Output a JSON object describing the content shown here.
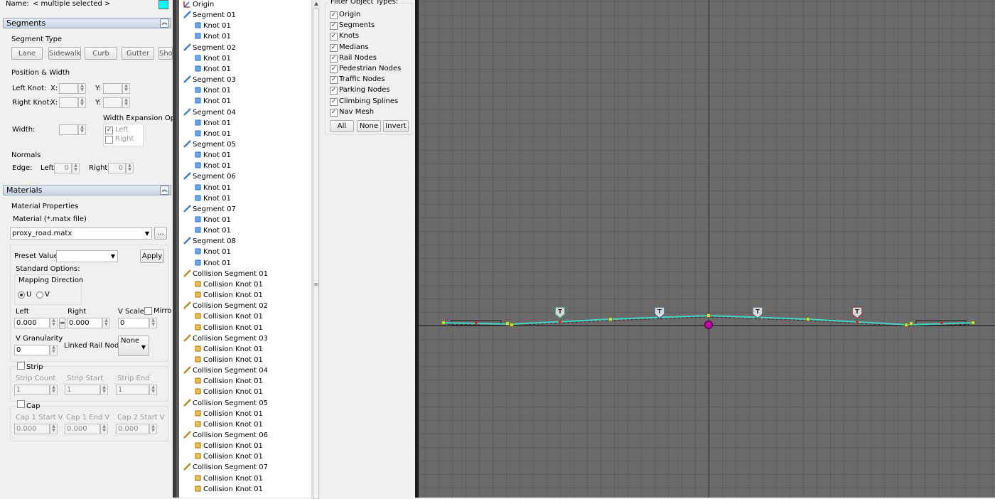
{
  "name_row": {
    "label": "Name:",
    "value": "< multiple selected >",
    "color": "#00ffff"
  },
  "segments_section": {
    "header": "Segments",
    "segment_type_label": "Segment Type",
    "segment_types": [
      "Lane",
      "Sidewalk",
      "Curb",
      "Gutter",
      "Sho"
    ],
    "position_width_label": "Position & Width",
    "left_knot_label": "Left Knot:",
    "right_knot_label": "Right Knot:",
    "x_label": "X:",
    "y_label": "Y:",
    "width_label": "Width:",
    "width_expansion_label": "Width Expansion Optic",
    "expansion_left": "Left",
    "expansion_right": "Right",
    "normals_label": "Normals",
    "edge_label": "Edge:",
    "left_label": "Left:",
    "right_label": "Right:",
    "left_value": "0",
    "right_value": "0"
  },
  "materials_section": {
    "header": "Materials",
    "material_properties_label": "Material Properties",
    "material_file_label": "Material (*.matx file)",
    "material_value": "proxy_road.matx",
    "browse_label": "...",
    "preset_values_label": "Preset Values:",
    "apply_label": "Apply",
    "standard_options_label": "Standard Options:",
    "mapping_direction_label": "Mapping Direction",
    "u_label": "U",
    "v_label": "V",
    "left_label": "Left",
    "right_label": "Right",
    "vscale_label": "V Scale",
    "mirror_label": "Mirro",
    "left_value": "0.000",
    "right_value": "0.000",
    "vscale_value": "0",
    "eq_label": "=",
    "v_granularity_label": "V Granularity",
    "v_granularity_value": "0",
    "linked_rail_label": "Linked Rail Node:",
    "linked_rail_value": "None",
    "strip_label": "Strip",
    "strip_count_label": "Strip Count",
    "strip_start_label": "Strip Start",
    "strip_end_label": "Strip End",
    "strip_count_value": "1",
    "strip_start_value": "1",
    "strip_end_value": "1",
    "cap_label": "Cap",
    "cap1_start_label": "Cap 1 Start V",
    "cap1_end_label": "Cap 1 End V",
    "cap2_start_label": "Cap 2 Start V",
    "cap1_start_value": "0.000",
    "cap1_end_value": "0.000",
    "cap2_start_value": "0.000"
  },
  "tree": [
    {
      "label": "Origin",
      "type": "origin",
      "indent": 0
    },
    {
      "label": "Segment 01",
      "type": "segment",
      "indent": 0
    },
    {
      "label": "Knot 01",
      "type": "knot",
      "indent": 1
    },
    {
      "label": "Knot 01",
      "type": "knot",
      "indent": 1
    },
    {
      "label": "Segment 02",
      "type": "segment",
      "indent": 0
    },
    {
      "label": "Knot 01",
      "type": "knot",
      "indent": 1
    },
    {
      "label": "Knot 01",
      "type": "knot",
      "indent": 1
    },
    {
      "label": "Segment 03",
      "type": "segment",
      "indent": 0
    },
    {
      "label": "Knot 01",
      "type": "knot",
      "indent": 1
    },
    {
      "label": "Knot 01",
      "type": "knot",
      "indent": 1
    },
    {
      "label": "Segment 04",
      "type": "segment",
      "indent": 0
    },
    {
      "label": "Knot 01",
      "type": "knot",
      "indent": 1
    },
    {
      "label": "Knot 01",
      "type": "knot",
      "indent": 1
    },
    {
      "label": "Segment 05",
      "type": "segment",
      "indent": 0
    },
    {
      "label": "Knot 01",
      "type": "knot",
      "indent": 1
    },
    {
      "label": "Knot 01",
      "type": "knot",
      "indent": 1
    },
    {
      "label": "Segment 06",
      "type": "segment",
      "indent": 0
    },
    {
      "label": "Knot 01",
      "type": "knot",
      "indent": 1
    },
    {
      "label": "Knot 01",
      "type": "knot",
      "indent": 1
    },
    {
      "label": "Segment 07",
      "type": "segment",
      "indent": 0
    },
    {
      "label": "Knot 01",
      "type": "knot",
      "indent": 1
    },
    {
      "label": "Knot 01",
      "type": "knot",
      "indent": 1
    },
    {
      "label": "Segment 08",
      "type": "segment",
      "indent": 0
    },
    {
      "label": "Knot 01",
      "type": "knot",
      "indent": 1
    },
    {
      "label": "Knot 01",
      "type": "knot",
      "indent": 1
    },
    {
      "label": "Collision Segment 01",
      "type": "collision-segment",
      "indent": 0
    },
    {
      "label": "Collision Knot 01",
      "type": "collision-knot",
      "indent": 1
    },
    {
      "label": "Collision Knot 01",
      "type": "collision-knot",
      "indent": 1
    },
    {
      "label": "Collision Segment 02",
      "type": "collision-segment",
      "indent": 0
    },
    {
      "label": "Collision Knot 01",
      "type": "collision-knot",
      "indent": 1
    },
    {
      "label": "Collision Knot 01",
      "type": "collision-knot",
      "indent": 1
    },
    {
      "label": "Collision Segment 03",
      "type": "collision-segment",
      "indent": 0
    },
    {
      "label": "Collision Knot 01",
      "type": "collision-knot",
      "indent": 1
    },
    {
      "label": "Collision Knot 01",
      "type": "collision-knot",
      "indent": 1
    },
    {
      "label": "Collision Segment 04",
      "type": "collision-segment",
      "indent": 0
    },
    {
      "label": "Collision Knot 01",
      "type": "collision-knot",
      "indent": 1
    },
    {
      "label": "Collision Knot 01",
      "type": "collision-knot",
      "indent": 1
    },
    {
      "label": "Collision Segment 05",
      "type": "collision-segment",
      "indent": 0
    },
    {
      "label": "Collision Knot 01",
      "type": "collision-knot",
      "indent": 1
    },
    {
      "label": "Collision Knot 01",
      "type": "collision-knot",
      "indent": 1
    },
    {
      "label": "Collision Segment 06",
      "type": "collision-segment",
      "indent": 0
    },
    {
      "label": "Collision Knot 01",
      "type": "collision-knot",
      "indent": 1
    },
    {
      "label": "Collision Knot 01",
      "type": "collision-knot",
      "indent": 1
    },
    {
      "label": "Collision Segment 07",
      "type": "collision-segment",
      "indent": 0
    },
    {
      "label": "Collision Knot 01",
      "type": "collision-knot",
      "indent": 1
    },
    {
      "label": "Collision Knot 01",
      "type": "collision-knot",
      "indent": 1
    }
  ],
  "filter": {
    "title": "Filter Object Types:",
    "items": [
      {
        "label": "Origin",
        "checked": true
      },
      {
        "label": "Segments",
        "checked": true
      },
      {
        "label": "Knots",
        "checked": true
      },
      {
        "label": "Medians",
        "checked": true
      },
      {
        "label": "Rail Nodes",
        "checked": true
      },
      {
        "label": "Pedestrian Nodes",
        "checked": true
      },
      {
        "label": "Traffic Nodes",
        "checked": true
      },
      {
        "label": "Parking Nodes",
        "checked": true
      },
      {
        "label": "Climbing Splines",
        "checked": true
      },
      {
        "label": "Nav Mesh",
        "checked": true
      }
    ],
    "all_label": "All",
    "none_label": "None",
    "invert_label": "Invert"
  },
  "viewport": {
    "background": "#6a6a6a",
    "grid_color": "#5f5f5f",
    "spline_color": "#3fd6c4",
    "origin_color": "#c000a0",
    "node_label": "T"
  }
}
